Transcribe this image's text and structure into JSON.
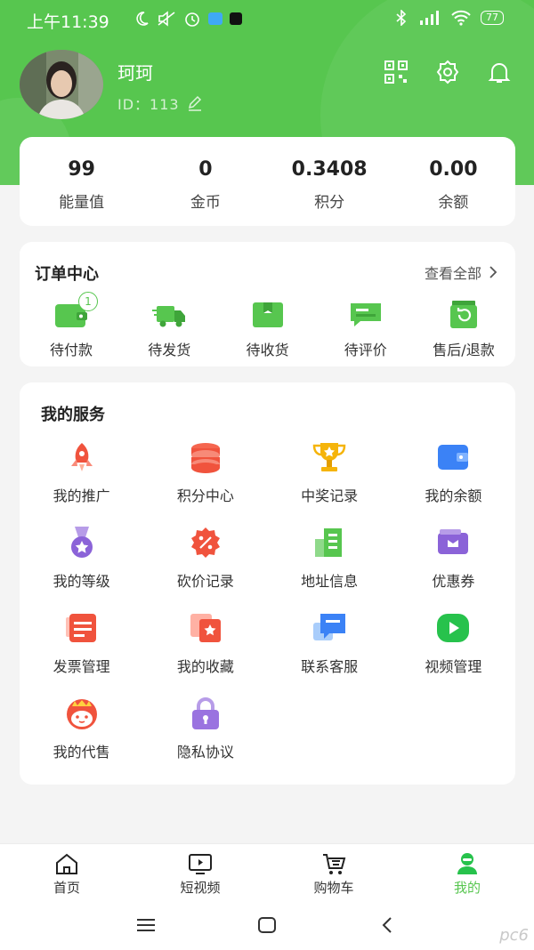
{
  "status_bar": {
    "time": "上午11:39",
    "battery": "77"
  },
  "profile": {
    "name": "珂珂",
    "id_text": "ID：113"
  },
  "stats": [
    {
      "value": "99",
      "label": "能量值"
    },
    {
      "value": "0",
      "label": "金币"
    },
    {
      "value": "0.3408",
      "label": "积分"
    },
    {
      "value": "0.00",
      "label": "余额"
    }
  ],
  "orders": {
    "title": "订单中心",
    "view_all": "查看全部",
    "pending_payment_badge": "1",
    "items": [
      {
        "label": "待付款",
        "icon": "wallet-icon"
      },
      {
        "label": "待发货",
        "icon": "truck-icon"
      },
      {
        "label": "待收货",
        "icon": "box-icon"
      },
      {
        "label": "待评价",
        "icon": "comment-icon"
      },
      {
        "label": "售后/退款",
        "icon": "refund-icon"
      }
    ]
  },
  "services": {
    "title": "我的服务",
    "items": [
      {
        "label": "我的推广",
        "icon": "rocket-icon"
      },
      {
        "label": "积分中心",
        "icon": "coins-icon"
      },
      {
        "label": "中奖记录",
        "icon": "trophy-icon"
      },
      {
        "label": "我的余额",
        "icon": "wallet-blue-icon"
      },
      {
        "label": "我的等级",
        "icon": "medal-icon"
      },
      {
        "label": "砍价记录",
        "icon": "discount-icon"
      },
      {
        "label": "地址信息",
        "icon": "building-icon"
      },
      {
        "label": "优惠券",
        "icon": "coupon-icon"
      },
      {
        "label": "发票管理",
        "icon": "invoice-icon"
      },
      {
        "label": "我的收藏",
        "icon": "favorite-icon"
      },
      {
        "label": "联系客服",
        "icon": "chat-icon"
      },
      {
        "label": "视频管理",
        "icon": "play-icon"
      },
      {
        "label": "我的代售",
        "icon": "mascot-icon"
      },
      {
        "label": "隐私协议",
        "icon": "lock-icon"
      }
    ]
  },
  "tabbar": [
    {
      "label": "首页",
      "icon": "home-icon"
    },
    {
      "label": "短视频",
      "icon": "tv-icon"
    },
    {
      "label": "购物车",
      "icon": "cart-icon"
    },
    {
      "label": "我的",
      "icon": "user-icon",
      "active": true
    }
  ],
  "colors": {
    "brand_green": "#57c64f"
  },
  "watermark": "pc6"
}
